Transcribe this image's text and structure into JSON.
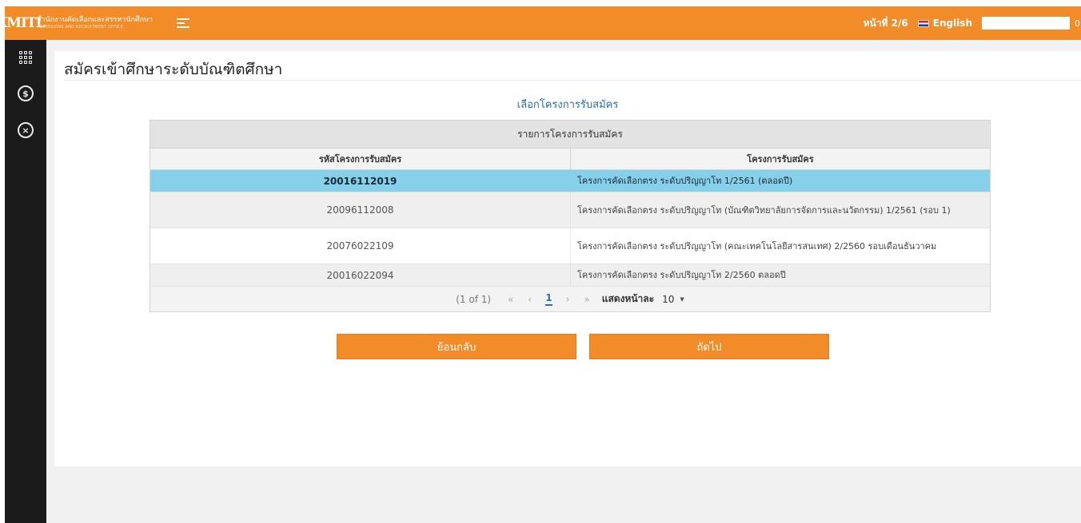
{
  "header": {
    "logo_text": "KMITL",
    "org_name_th": "สำนักงานคัดเลือกและสรรหานักศึกษา",
    "org_name_en": "ADMISSIONS AND RECRUITMENT OFFICE",
    "page_indicator": "หน้าที่ 2/6",
    "language_label": "English",
    "user_extra": "0"
  },
  "sidebar": {
    "items": [
      {
        "icon": "grid-icon"
      },
      {
        "icon": "currency-icon",
        "glyph": "$"
      },
      {
        "icon": "close-circle-icon",
        "glyph": "×"
      }
    ]
  },
  "main": {
    "title": "สมัครเข้าศึกษาระดับบัณฑิตศึกษา",
    "section_heading": "เลือกโครงการรับสมัคร",
    "table": {
      "caption": "รายการโครงการรับสมัคร",
      "columns": [
        "รหัสโครงการรับสมัคร",
        "โครงการรับสมัคร"
      ],
      "rows": [
        {
          "code": "20016112019",
          "program": "โครงการคัดเลือกตรง ระดับปริญญาโท 1/2561 (ตลอดปี)",
          "selected": true
        },
        {
          "code": "20096112008",
          "program": "โครงการคัดเลือกตรง ระดับปริญญาโท (บัณฑิตวิทยาลัยการจัดการและนวัตกรรม) 1/2561 (รอบ 1)",
          "selected": false
        },
        {
          "code": "20076022109",
          "program": "โครงการคัดเลือกตรง ระดับปริญญาโท (คณะเทคโนโลยีสารสนเทศ) 2/2560 รอบเดือนธันวาคม",
          "selected": false
        },
        {
          "code": "20016022094",
          "program": "โครงการคัดเลือกตรง ระดับปริญญาโท 2/2560 ตลอดปี",
          "selected": false
        }
      ]
    },
    "paginator": {
      "status": "(1 of 1)",
      "first": "«",
      "prev": "‹",
      "page": "1",
      "next": "›",
      "last": "»",
      "rows_label": "แสดงหน้าละ",
      "rows_value": "10",
      "rows_caret": "▼"
    },
    "buttons": {
      "back": "ย้อนกลับ",
      "next": "ถัดไป"
    }
  },
  "colors": {
    "accent": "#f28c28",
    "sidebar": "#1b1b1b",
    "selected_row": "#87d0ea",
    "link": "#2a6fa8"
  }
}
